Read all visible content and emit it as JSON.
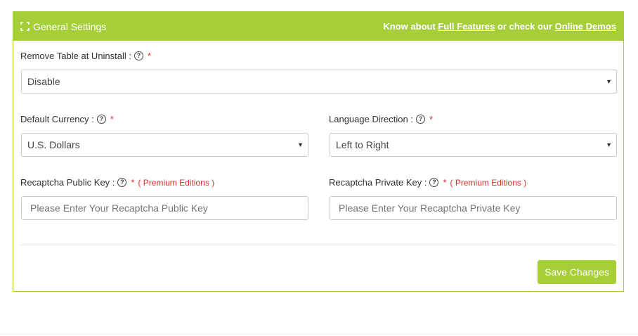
{
  "header": {
    "title": "General Settings",
    "know_prefix": "Know about ",
    "full_features": "Full Features",
    "or_check": " or check our ",
    "online_demos": "Online Demos"
  },
  "fields": {
    "remove_table": {
      "label": "Remove Table at Uninstall :",
      "required": "*",
      "value": "Disable"
    },
    "currency": {
      "label": "Default Currency :",
      "required": "*",
      "value": "U.S. Dollars"
    },
    "language": {
      "label": "Language Direction :",
      "required": "*",
      "value": "Left to Right"
    },
    "public_key": {
      "label": "Recaptcha Public Key :",
      "required": "*",
      "premium": "( Premium Editions )",
      "placeholder": "Please Enter Your Recaptcha Public Key"
    },
    "private_key": {
      "label": "Recaptcha Private Key :",
      "required": "*",
      "premium": "( Premium Editions )",
      "placeholder": "Please Enter Your Recaptcha Private Key"
    }
  },
  "save_label": "Save Changes",
  "icons": {
    "help": "?",
    "caret": "▼"
  },
  "colors": {
    "accent": "#a6ce39",
    "required": "#d9302c"
  }
}
